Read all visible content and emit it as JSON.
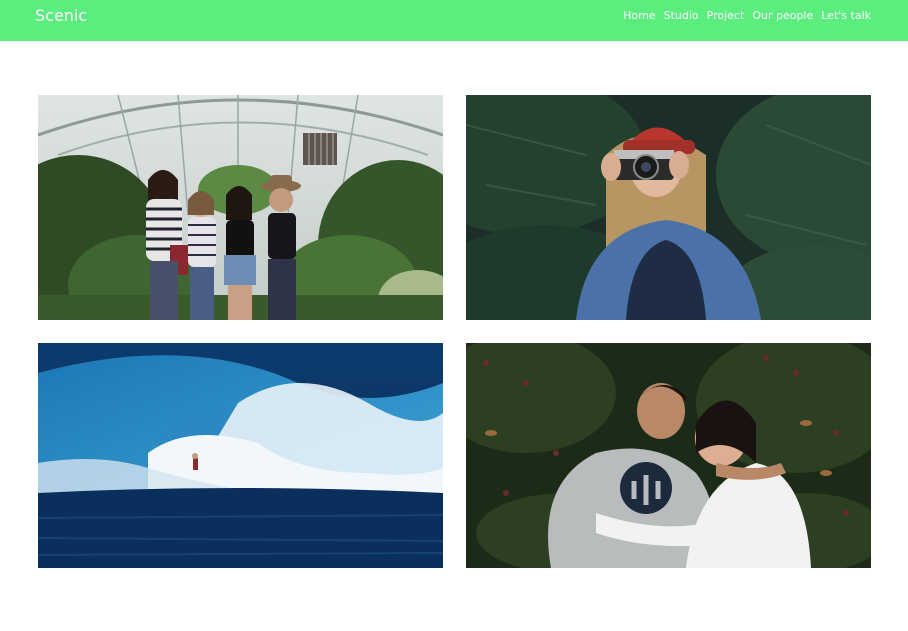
{
  "header": {
    "brand": "Scenic",
    "accent_color": "#5ced7f",
    "nav": [
      {
        "label": "Home"
      },
      {
        "label": "Studio"
      },
      {
        "label": "Project"
      },
      {
        "label": "Our people"
      },
      {
        "label": "Let's talk"
      }
    ]
  },
  "gallery": {
    "photos": [
      {
        "subject": "four-friends-in-greenhouse"
      },
      {
        "subject": "woman-with-camera-red-beanie"
      },
      {
        "subject": "surfer-on-large-wave"
      },
      {
        "subject": "couple-lying-on-grass"
      }
    ]
  }
}
